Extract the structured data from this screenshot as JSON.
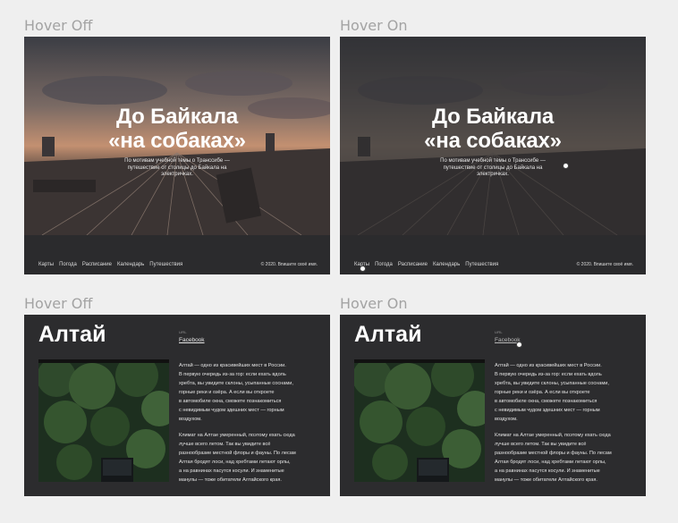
{
  "states": {
    "top_left": "Hover Off",
    "top_right": "Hover On",
    "bottom_left": "Hover Off",
    "bottom_right": "Hover On"
  },
  "hero": {
    "title_line1": "До Байкала",
    "title_line2": "«на собаках»",
    "subtitle": "По мотивам учебной темы о Транссибе — путешествие от столицы до Байкала на электричках.",
    "nav": [
      "Карты",
      "Погода",
      "Расписание",
      "Календарь",
      "Путешествия"
    ],
    "copyright": "© 2020. Впишите своё имя."
  },
  "altai": {
    "heading": "Алтай",
    "url_label": "URL",
    "link": "Facebook",
    "paragraph1": "Алтай — одно из красивейших мест в России.\nВ первую очередь из-за гор: если ехать вдоль\nхребта, вы увидите склоны, усыпанные соснами,\nгорные реки и озёра. А если вы откроете\nв автомобиле окна, сможете познакомиться\nс невидимым чудом здешних мест — горным\nвоздухом.",
    "paragraph2": "Климат на Алтае умеренный, поэтому ехать сюда\nлучше всего летом. Так вы увидите всё\nразнообразие местной флоры и фауны. По лесам\nАлтая бродят лоси, над хребтами летают орлы,\nа на равнинах пасутся косули. И знаменитые\nманулы — тоже обитатели Алтайского края."
  }
}
